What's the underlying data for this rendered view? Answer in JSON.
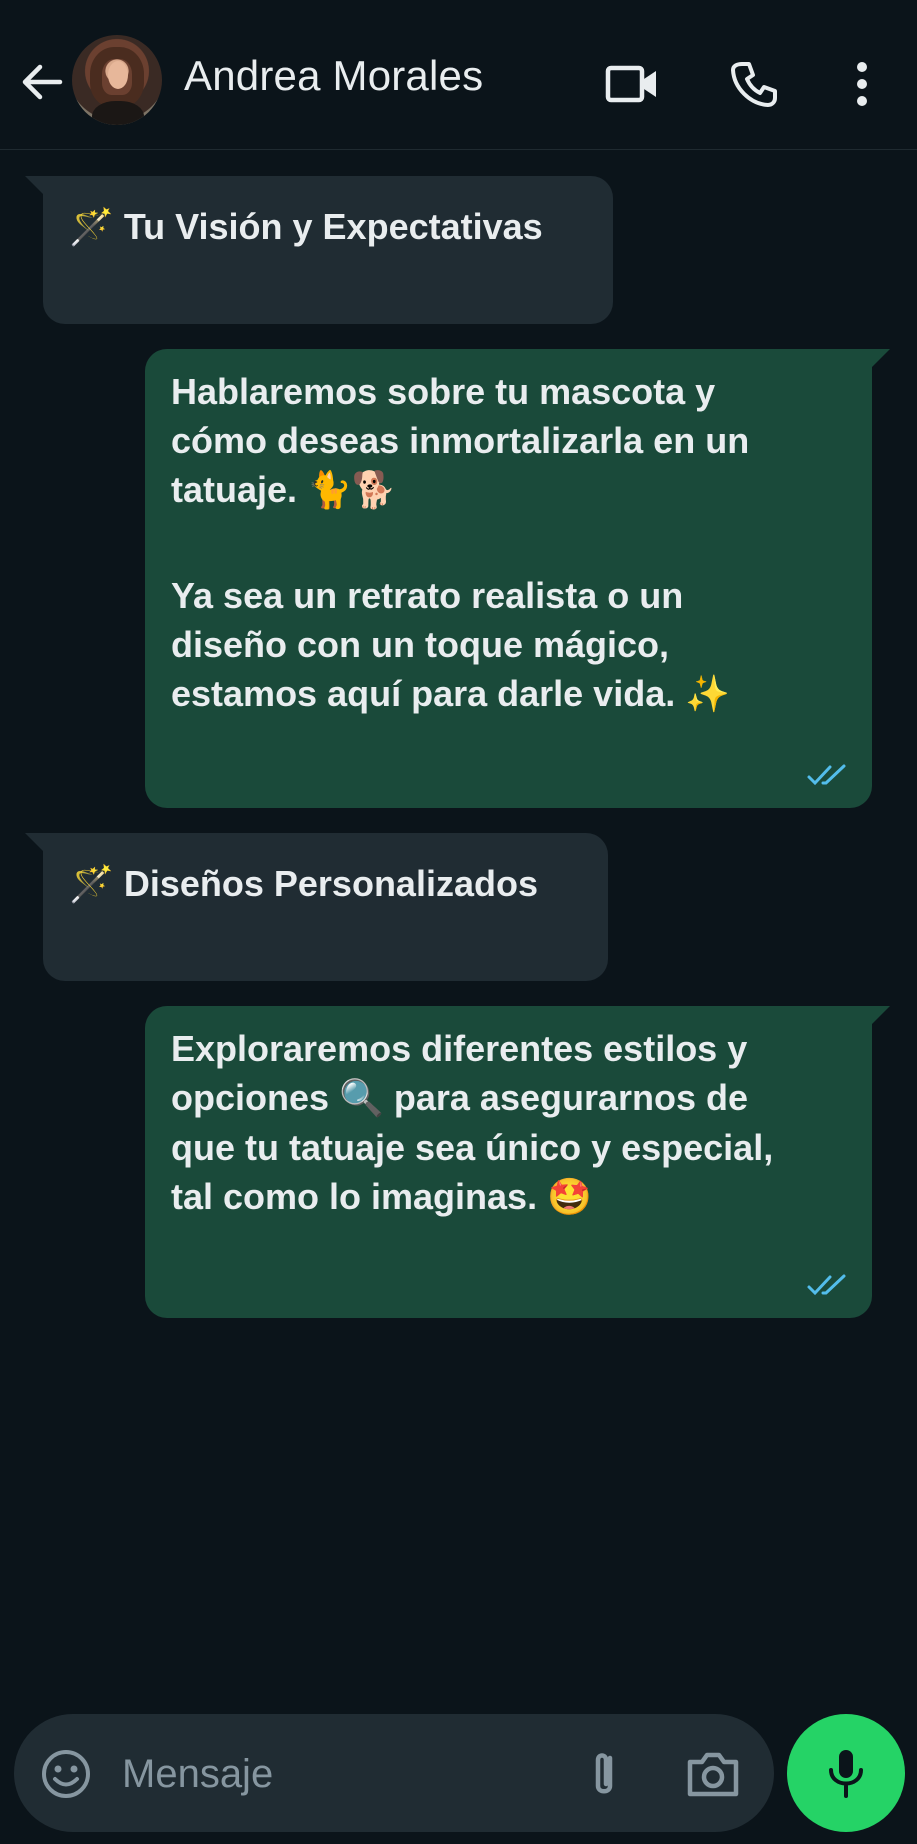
{
  "header": {
    "contact_name": "Andrea Morales",
    "back_icon": "arrow-left-icon",
    "video_icon": "video-camera-icon",
    "call_icon": "phone-icon",
    "menu_icon": "kebab-menu-icon"
  },
  "messages": [
    {
      "direction": "in",
      "emoji": "🪄",
      "text": "Tu Visión y Expectativas"
    },
    {
      "direction": "out",
      "line1": "Hablaremos sobre tu mascota y",
      "line2": "cómo deseas inmortalizarla en un",
      "line3": "tatuaje.",
      "line3_emoji": "🐈🐕",
      "line4": "Ya sea un retrato realista o un",
      "line5": "diseño con un toque mágico,",
      "line6": "estamos aquí para darle vida.",
      "line6_emoji": "✨",
      "status": "read"
    },
    {
      "direction": "in",
      "emoji": "🪄",
      "text": "Diseños Personalizados"
    },
    {
      "direction": "out",
      "line1": "Exploraremos diferentes estilos y",
      "line2_a": "opciones",
      "line2_emoji": "🔍",
      "line2_b": "para asegurarnos de",
      "line3": "que tu tatuaje sea único y especial,",
      "line4": "tal como lo imaginas.",
      "line4_emoji": "🤩",
      "status": "read"
    }
  ],
  "composer": {
    "placeholder": "Mensaje",
    "emoji_icon": "smiley-icon",
    "attach_icon": "paperclip-icon",
    "camera_icon": "camera-icon",
    "mic_icon": "microphone-icon"
  },
  "colors": {
    "background": "#0b141a",
    "incoming_bubble": "#202c33",
    "outgoing_bubble": "#1a4a3a",
    "read_ticks": "#53bdeb",
    "mic_button": "#25d366"
  }
}
